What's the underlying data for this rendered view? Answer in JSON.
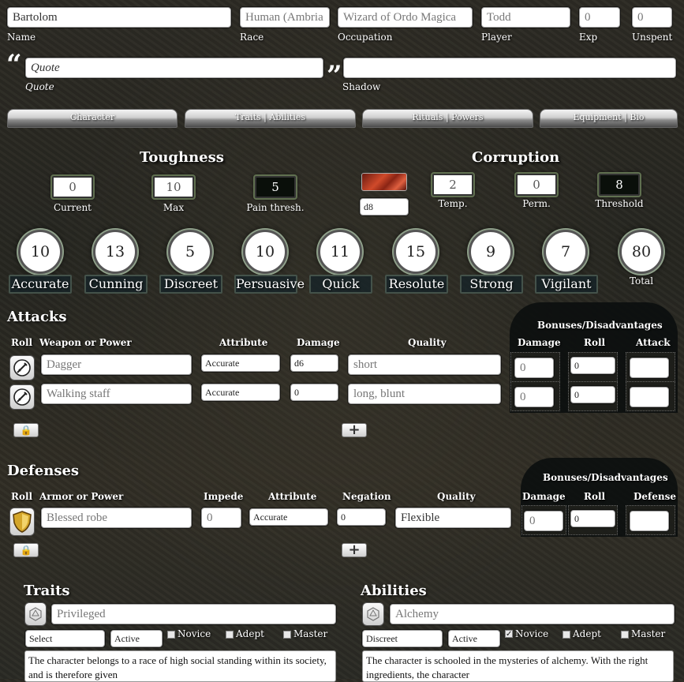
{
  "header": {
    "name": {
      "value": "Bartolom",
      "label": "Name"
    },
    "race": {
      "value": "Human (Ambria",
      "label": "Race"
    },
    "occupation": {
      "value": "Wizard of Ordo Magica",
      "label": "Occupation"
    },
    "player": {
      "value": "Todd",
      "label": "Player"
    },
    "exp": {
      "value": "0",
      "label": "Exp"
    },
    "unspent": {
      "value": "0",
      "label": "Unspent"
    },
    "quote": {
      "value": "Quote",
      "label": "Quote",
      "open_mark": "“",
      "close_mark": "”"
    },
    "shadow": {
      "value": "",
      "label": "Shadow"
    }
  },
  "tabs": [
    "Character",
    "Traits | Abilities",
    "Rituals | Powers",
    "Equipment | Bio"
  ],
  "toughness": {
    "title": "Toughness",
    "current": {
      "value": "0",
      "label": "Current"
    },
    "max": {
      "value": "10",
      "label": "Max"
    },
    "pain": {
      "value": "5",
      "label": "Pain thresh."
    }
  },
  "dice": {
    "value": "d8"
  },
  "corruption": {
    "title": "Corruption",
    "temp": {
      "value": "2",
      "label": "Temp."
    },
    "perm": {
      "value": "0",
      "label": "Perm."
    },
    "threshold": {
      "value": "8",
      "label": "Threshold"
    }
  },
  "attributes": [
    {
      "name": "Accurate",
      "value": "10"
    },
    {
      "name": "Cunning",
      "value": "13"
    },
    {
      "name": "Discreet",
      "value": "5"
    },
    {
      "name": "Persuasive",
      "value": "10"
    },
    {
      "name": "Quick",
      "value": "11"
    },
    {
      "name": "Resolute",
      "value": "15"
    },
    {
      "name": "Strong",
      "value": "9"
    },
    {
      "name": "Vigilant",
      "value": "7"
    }
  ],
  "total": {
    "value": "80",
    "label": "Total"
  },
  "attacks": {
    "title": "Attacks",
    "headers": {
      "roll": "Roll",
      "weapon": "Weapon or Power",
      "attribute": "Attribute",
      "damage": "Damage",
      "quality": "Quality"
    },
    "bonus_title": "Bonuses/Disadvantages",
    "bonus_headers": {
      "damage": "Damage",
      "roll": "Roll",
      "attack": "Attack"
    },
    "rows": [
      {
        "weapon": "Dagger",
        "attribute": "Accurate",
        "damage": "d6",
        "quality": "short",
        "b_damage": "0",
        "b_roll": "0",
        "b_attack": ""
      },
      {
        "weapon": "Walking staff",
        "attribute": "Accurate",
        "damage": "0",
        "quality": "long, blunt",
        "b_damage": "0",
        "b_roll": "0",
        "b_attack": ""
      }
    ]
  },
  "defenses": {
    "title": "Defenses",
    "headers": {
      "roll": "Roll",
      "armor": "Armor or Power",
      "impede": "Impede",
      "attribute": "Attribute",
      "negation": "Negation",
      "quality": "Quality"
    },
    "bonus_title": "Bonuses/Disadvantages",
    "bonus_headers": {
      "damage": "Damage",
      "roll": "Roll",
      "defense": "Defense"
    },
    "rows": [
      {
        "armor": "Blessed robe",
        "impede": "0",
        "attribute": "Accurate",
        "negation": "0",
        "quality": "Flexible",
        "b_damage": "0",
        "b_roll": "0",
        "b_defense": ""
      }
    ]
  },
  "buttons": {
    "lock": "🔒",
    "add": "+"
  },
  "traits": {
    "title": "Traits",
    "name": "Privileged",
    "select": "Select",
    "status": "Active",
    "levels": [
      "Novice",
      "Adept",
      "Master"
    ],
    "checked": [
      false,
      false,
      false
    ],
    "desc": "The character belongs to a race of high social standing within its society, and is therefore given"
  },
  "abilities": {
    "title": "Abilities",
    "name": "Alchemy",
    "select": "Discreet",
    "status": "Active",
    "levels": [
      "Novice",
      "Adept",
      "Master"
    ],
    "checked": [
      true,
      false,
      false
    ],
    "desc": "The character is schooled in the mysteries of alchemy. With the right ingredients, the character"
  },
  "colors": {
    "accent": "#607050",
    "panel": "#0a0f0e"
  }
}
